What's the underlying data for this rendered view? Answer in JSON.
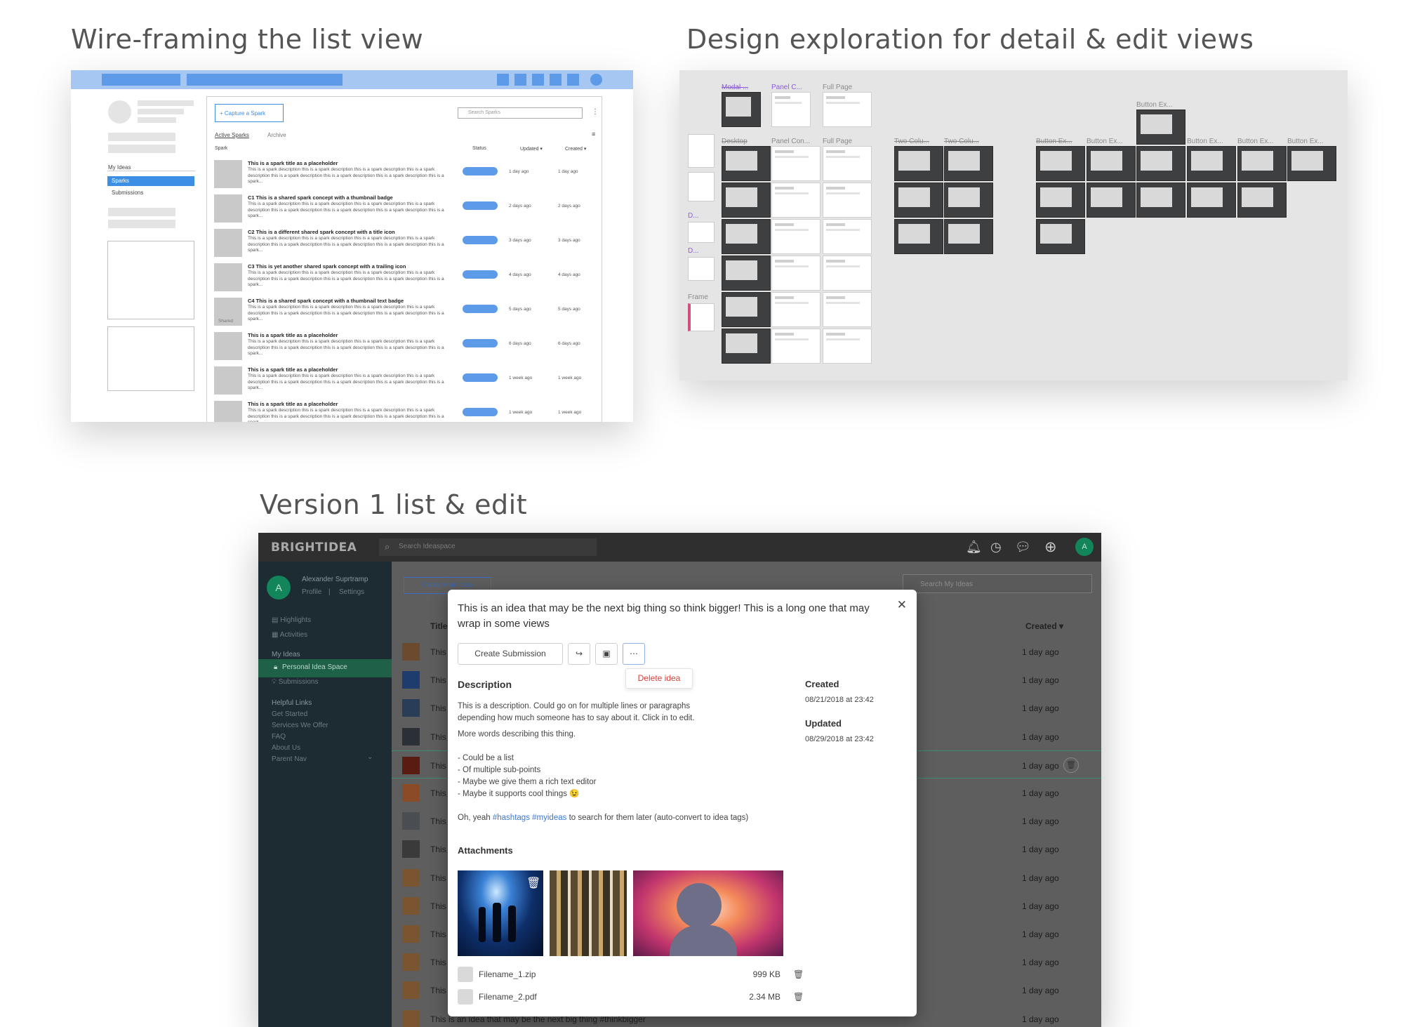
{
  "titles": {
    "wireframe": "Wire-framing the list view",
    "exploration": "Design exploration for detail & edit views",
    "version1": "Version 1 list & edit"
  },
  "wireframe": {
    "sidebar": {
      "section": "My Ideas",
      "items": [
        "Sparks",
        "Submissions"
      ]
    },
    "capture_button": "+ Capture a Spark",
    "search_placeholder": "Search Sparks",
    "tabs": [
      "Active Sparks",
      "Archive"
    ],
    "columns": [
      "Spark",
      "Status",
      "Updated ▾",
      "Created ▾"
    ],
    "desc": "This is a spark description this is a spark description this is a spark description this is a spark description this is a spark description this is a spark description this is a spark description this is a spark...",
    "shared_label": "Shared",
    "rows": [
      {
        "title": "This is a spark title as a placeholder",
        "updated": "1 day ago",
        "created": "1 day ago"
      },
      {
        "title": "C1 This is a shared spark concept with a thumbnail badge",
        "updated": "2 days ago",
        "created": "2 days ago"
      },
      {
        "title": "C2 This is a different shared spark concept with a title icon",
        "updated": "3 days ago",
        "created": "3 days ago"
      },
      {
        "title": "C3 This is yet another shared spark concept with a trailing icon",
        "updated": "4 days ago",
        "created": "4 days ago"
      },
      {
        "title": "C4 This is a shared spark concept with a thumbnail text badge",
        "updated": "5 days ago",
        "created": "5 days ago"
      },
      {
        "title": "This is a spark title as a placeholder",
        "updated": "6 days ago",
        "created": "6 days ago"
      },
      {
        "title": "This is a spark title as a placeholder",
        "updated": "1 week ago",
        "created": "1 week ago"
      },
      {
        "title": "This is a spark title as a placeholder",
        "updated": "1 week ago",
        "created": "1 week ago"
      }
    ]
  },
  "exploration": {
    "labels": {
      "modal": "Modal ...",
      "panel_c": "Panel C...",
      "full_page": "Full Page",
      "desktop": "Desktop",
      "panel_con": "Panel Con...",
      "two_colu": "Two Colu...",
      "button_ex": "Button Ex...",
      "frame": "Frame",
      "d": "D..."
    }
  },
  "app": {
    "logo": "BRIGHTIDEA",
    "search_placeholder": "Search Ideaspace",
    "user": {
      "initial": "A",
      "name": "Alexander Suprtramp",
      "profile": "Profile",
      "settings": "Settings",
      "separator": "|"
    },
    "nav": [
      "Highlights",
      "Activities"
    ],
    "my_ideas": "My Ideas",
    "personal_space": "Personal Idea Space",
    "submissions": "Submissions",
    "helpful_links": "Helpful Links",
    "links": [
      "Get Started",
      "Services We Offer",
      "FAQ",
      "About Us",
      "Parent Nav"
    ],
    "capture_button": "Capture an Idea",
    "search_my_ideas": "Search My Ideas",
    "col_title": "Title",
    "col_created": "Created ▾",
    "row_title": "This",
    "row_date": "1 day ago",
    "last_row_title": "This is an idea that may be the next big thing #thinkbigger"
  },
  "modal": {
    "title": "This is an idea that may be the next big thing so think bigger! This is a long one that may wrap in some views",
    "create_submission": "Create Submission",
    "delete_idea": "Delete idea",
    "description_heading": "Description",
    "description_lines": [
      "This is a description. Could go on for multiple lines or paragraphs depending how much someone has to say about it. Click in to edit.",
      "More words describing this thing.",
      "- Could be a list",
      "- Of multiple sub-points",
      "- Maybe we give them a rich text editor",
      "- Maybe it supports cool things 😉"
    ],
    "hashtag_pre": "Oh, yeah",
    "hashtag_1": "#hashtags",
    "hashtag_2": "#myideas",
    "hashtag_post": "to search for them later (auto-convert to idea tags)",
    "created_heading": "Created",
    "created_value": "08/21/2018 at 23:42",
    "updated_heading": "Updated",
    "updated_value": "08/29/2018 at 23:42",
    "attachments_heading": "Attachments",
    "files": [
      {
        "name": "Filename_1.zip",
        "size": "999 KB"
      },
      {
        "name": "Filename_2.pdf",
        "size": "2.34 MB"
      }
    ]
  }
}
